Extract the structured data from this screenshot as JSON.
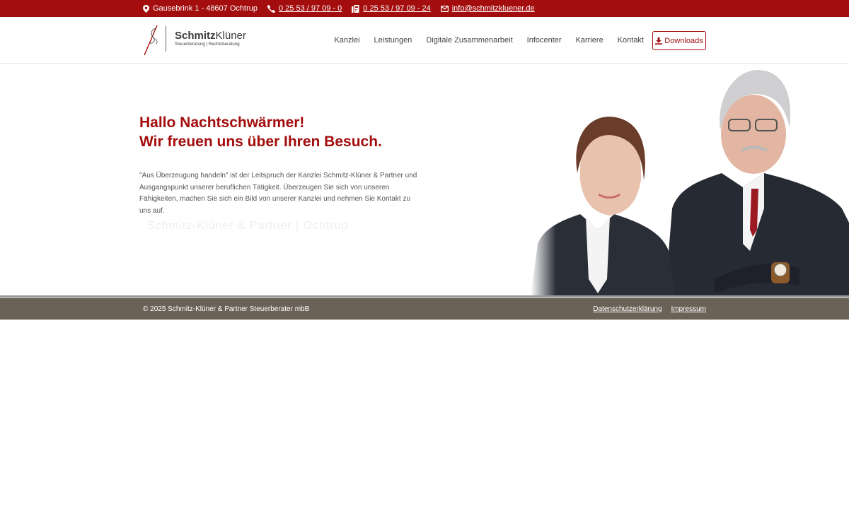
{
  "topbar": {
    "address": "Gausebrink 1 - 48607 Ochtrup",
    "phone": "0 25 53 / 97 09 - 0",
    "fax": "0 25 53 / 97 09 - 24",
    "email": "info@schmitzkluener.de",
    "address_icon": "map-marker-icon",
    "phone_icon": "phone-icon",
    "fax_icon": "fax-icon",
    "email_icon": "envelope-icon"
  },
  "logo": {
    "name_bold": "Schmitz",
    "name_rest": "Klüner",
    "subtitle": "Steuerberatung  |  Rechtsberatung"
  },
  "nav": {
    "items": [
      "Kanzlei",
      "Leistungen",
      "Digitale Zusammenarbeit",
      "Infocenter",
      "Karriere",
      "Kontakt"
    ],
    "downloads_label": "Downloads",
    "downloads_icon": "download-icon"
  },
  "hero": {
    "title_line1": "Hallo Nachtschwärmer!",
    "title_line2": "Wir freuen uns über Ihren Besuch.",
    "text": "\"Aus Überzeugung handeln\" ist der Leitspruch der Kanzlei Schmitz-Klüner & Partner und Ausgangspunkt unserer beruflichen Tätigkeit. Überzeugen Sie sich von unseren Fähigkeiten, machen Sie sich ein Bild von unserer Kanzlei und nehmen Sie Kontakt zu uns auf.",
    "watermark": "Schmitz-Klüner & Partner | Ochtrup"
  },
  "footer": {
    "copyright": "© 2025 Schmitz-Klüner & Partner Steuerberater mbB",
    "links": [
      "Datenschutzerklärung",
      "Impressum"
    ]
  },
  "colors": {
    "brand": "#a30d0d",
    "footer_bg": "#6b6257"
  }
}
